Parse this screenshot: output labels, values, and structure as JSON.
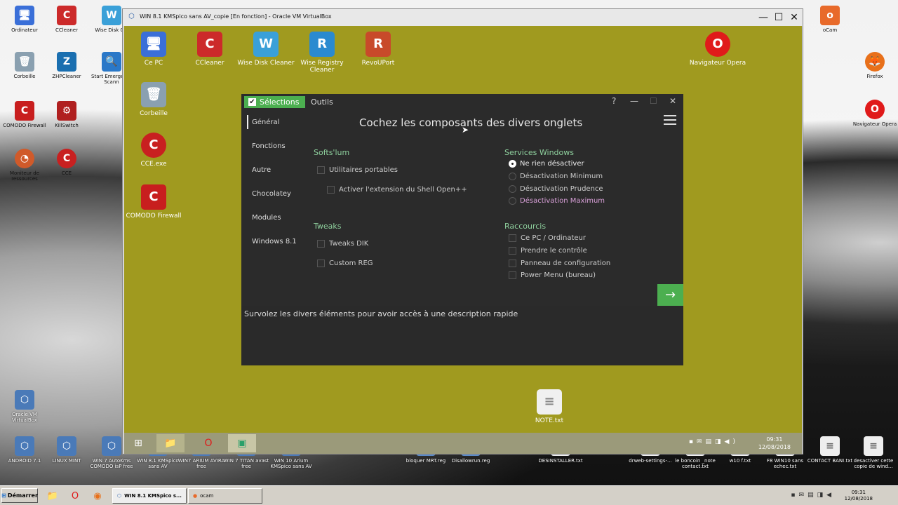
{
  "host_desktop": {
    "icons_left": [
      {
        "label": "Ordinateur",
        "icon": "computer-icon"
      },
      {
        "label": "CCleaner",
        "icon": "ccleaner-icon"
      },
      {
        "label": "Wise Disk Cle",
        "icon": "wise-disk-icon"
      },
      {
        "label": "Corbeille",
        "icon": "recycle-bin-icon"
      },
      {
        "label": "ZHPCleaner",
        "icon": "zhpcleaner-icon"
      },
      {
        "label": "Start Emerge Kit Scann",
        "icon": "search-icon"
      },
      {
        "label": "COMODO Firewall",
        "icon": "comodo-icon"
      },
      {
        "label": "KillSwitch",
        "icon": "killswitch-icon"
      },
      {
        "label": "Moniteur de ressources",
        "icon": "gauge-icon"
      },
      {
        "label": "CCE",
        "icon": "cce-icon"
      },
      {
        "label": "Oracle VM VirtualBox",
        "icon": "virtualbox-icon"
      }
    ],
    "icons_right": [
      {
        "label": "oCam",
        "icon": "ocam-icon"
      },
      {
        "label": "Firefox",
        "icon": "firefox-icon"
      },
      {
        "label": "Navigateur Opera",
        "icon": "opera-icon"
      }
    ],
    "icons_bottom": [
      {
        "label": "ANDROID 7.1"
      },
      {
        "label": "LINUX MINT"
      },
      {
        "label": "WIN 7 AutoKms COMODO isP free"
      },
      {
        "label": "WIN 8.1 KMSpico sans AV"
      },
      {
        "label": "WIN7 ARIUM AVIRA free"
      },
      {
        "label": "WIN 7 TITAN avast free"
      },
      {
        "label": "WIN 10 Arium KMSpico sans AV"
      },
      {
        "label": "bloquer MRT.reg"
      },
      {
        "label": "Disallowrun.reg"
      },
      {
        "label": "DESINSTALLER.txt"
      },
      {
        "label": "drweb-settings-..."
      },
      {
        "label": "le boncoin _note contact.txt"
      },
      {
        "label": "w10 f.txt"
      },
      {
        "label": "F8 WIN10 sans echec.txt"
      },
      {
        "label": "CONTACT BANI.txt"
      },
      {
        "label": "desactiver cette copie de wind..."
      }
    ]
  },
  "vm_window": {
    "title": "WIN 8.1  KMSpico sans AV_copie [En fonction] - Oracle VM VirtualBox",
    "minimize": "—",
    "maximize": "☐",
    "close": "✕"
  },
  "guest_desktop": {
    "icons": [
      {
        "label": "Ce PC",
        "icon": "pc-icon"
      },
      {
        "label": "CCleaner",
        "icon": "ccleaner-icon"
      },
      {
        "label": "Wise Disk Cleaner",
        "icon": "wise-disk-icon"
      },
      {
        "label": "Wise Registry Cleaner",
        "icon": "wise-registry-icon"
      },
      {
        "label": "RevoUPort",
        "icon": "revo-icon"
      },
      {
        "label": "Navigateur Opera",
        "icon": "opera-icon"
      },
      {
        "label": "Corbeille",
        "icon": "recycle-bin-icon"
      },
      {
        "label": "CCE.exe",
        "icon": "cce-icon"
      },
      {
        "label": "COMODO Firewall",
        "icon": "comodo-icon"
      },
      {
        "label": "NOTE.txt",
        "icon": "text-file-icon"
      }
    ],
    "clock_time": "09:31",
    "clock_date": "12/08/2018"
  },
  "app": {
    "tabs": {
      "selections": "Sélections",
      "outils": "Outils"
    },
    "controls": {
      "help": "?",
      "minimize": "—",
      "maximize": "☐",
      "close": "✕"
    },
    "heading": "Cochez les composants des divers onglets",
    "nav": [
      "Général",
      "Fonctions",
      "Autre",
      "Chocolatey",
      "Modules",
      "Windows 8.1"
    ],
    "softslum": {
      "title": "Softs'lum",
      "options": [
        "Utilitaires portables",
        "Activer l'extension du Shell Open++"
      ]
    },
    "tweaks": {
      "title": "Tweaks",
      "options": [
        "Tweaks DIK",
        "Custom REG"
      ]
    },
    "services": {
      "title": "Services Windows",
      "options": [
        "Ne rien désactiver",
        "Désactivation Minimum",
        "Désactivation Prudence",
        "Désactivation Maximum"
      ],
      "selected": "Ne rien désactiver"
    },
    "raccourcis": {
      "title": "Raccourcis",
      "options": [
        "Ce PC / Ordinateur",
        "Prendre le contrôle",
        "Panneau de configuration",
        "Power Menu (bureau)"
      ]
    },
    "next_arrow": "→",
    "description": "Survolez les divers éléments pour avoir accès à une description rapide",
    "colors": {
      "accent": "#4caf50",
      "section": "#8fd19e",
      "maximum": "#d9a0d9"
    }
  },
  "host_taskbar": {
    "start": "Démarrer",
    "tasks": [
      {
        "label": "WIN 8.1  KMSpico s..."
      },
      {
        "label": "ocam"
      }
    ],
    "clock_time": "09:31",
    "clock_date": "12/08/2018"
  }
}
